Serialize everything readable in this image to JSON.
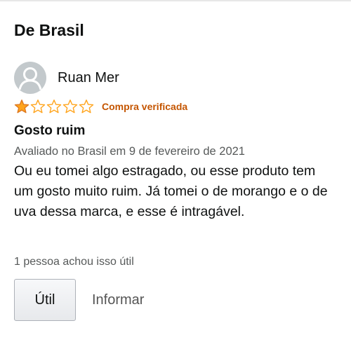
{
  "section": {
    "title": "De Brasil"
  },
  "review": {
    "reviewer_name": "Ruan Mer",
    "avatar_icon": "user-avatar-icon",
    "rating": 1,
    "rating_max": 5,
    "star_color": "#ffa41c",
    "verified_label": "Compra verificada",
    "verified_color": "#c45500",
    "title": "Gosto ruim",
    "date_text": "Avaliado no Brasil em 9 de fevereiro de 2021",
    "body": "Ou eu tomei algo estragado, ou esse produto tem um gosto muito ruim. Já tomei o de morango e o de uva dessa marca, e esse é intragável.",
    "helpful_count_text": "1 pessoa achou isso útil"
  },
  "actions": {
    "helpful_label": "Útil",
    "report_label": "Informar"
  }
}
